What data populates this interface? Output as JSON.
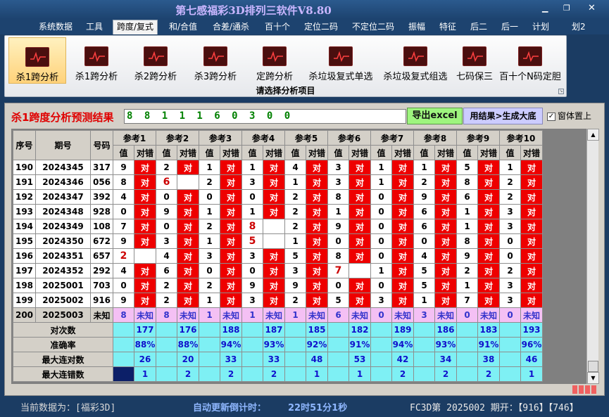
{
  "window": {
    "title": "第七感福彩3D排列三软件V8.80",
    "minimize_icon": "minimize-icon",
    "restore_icon": "restore-icon",
    "close_icon": "close-icon"
  },
  "menu": [
    "系统数据",
    "工具",
    "跨度/复式",
    "和/合值",
    "合差/通杀",
    "百十个",
    "定位二码",
    "不定位二码",
    "振幅",
    "特征",
    "后二",
    "后一",
    "计划",
    "划2"
  ],
  "active_menu": "跨度/复式",
  "ribbon": {
    "buttons": [
      "杀1跨分析",
      "杀1跨分析",
      "杀2跨分析",
      "杀3跨分析",
      "定跨分析",
      "杀垃圾复式单选",
      "杀垃圾复式组选",
      "七码保三",
      "百十个N码定胆"
    ],
    "active_index": 0,
    "caption": "请选择分析项目",
    "icon": "chart-icon"
  },
  "result": {
    "title": "杀1跨度分析预测结果",
    "value": "8 8 1 1 1 6 0 3 0 0",
    "excel_button": "导出excel",
    "generate_button": "用结果>生成大底",
    "pin_label": "窗体置上",
    "pin_checked": true
  },
  "table": {
    "col_seq": "序号",
    "col_period": "期号",
    "col_number": "号码",
    "refs": [
      "参考1",
      "参考2",
      "参考3",
      "参考4",
      "参考5",
      "参考6",
      "参考7",
      "参考8",
      "参考9",
      "参考10"
    ],
    "sub_val": "值",
    "sub_ok": "对错",
    "rows": [
      {
        "seq": "190",
        "period": "2024345",
        "num": "317",
        "vals": [
          "9",
          "2",
          "1",
          "1",
          "4",
          "3",
          "1",
          "1",
          "5",
          "1"
        ],
        "miss": []
      },
      {
        "seq": "191",
        "period": "2024346",
        "num": "056",
        "vals": [
          "8",
          "6",
          "2",
          "3",
          "1",
          "3",
          "1",
          "2",
          "8",
          "2"
        ],
        "miss": [
          1
        ]
      },
      {
        "seq": "192",
        "period": "2024347",
        "num": "392",
        "vals": [
          "4",
          "0",
          "0",
          "0",
          "2",
          "8",
          "0",
          "9",
          "6",
          "2"
        ],
        "miss": []
      },
      {
        "seq": "193",
        "period": "2024348",
        "num": "928",
        "vals": [
          "0",
          "9",
          "1",
          "1",
          "2",
          "1",
          "0",
          "6",
          "1",
          "3"
        ],
        "miss": []
      },
      {
        "seq": "194",
        "period": "2024349",
        "num": "108",
        "vals": [
          "7",
          "0",
          "2",
          "8",
          "2",
          "9",
          "0",
          "6",
          "1",
          "3"
        ],
        "miss": [
          3
        ]
      },
      {
        "seq": "195",
        "period": "2024350",
        "num": "672",
        "vals": [
          "9",
          "3",
          "1",
          "5",
          "1",
          "0",
          "0",
          "0",
          "8",
          "0"
        ],
        "miss": [
          3
        ]
      },
      {
        "seq": "196",
        "period": "2024351",
        "num": "657",
        "vals": [
          "2",
          "4",
          "3",
          "3",
          "5",
          "8",
          "0",
          "4",
          "9",
          "0"
        ],
        "miss": [
          0
        ]
      },
      {
        "seq": "197",
        "period": "2024352",
        "num": "292",
        "vals": [
          "4",
          "6",
          "0",
          "0",
          "3",
          "7",
          "1",
          "5",
          "2",
          "2"
        ],
        "miss": [
          5
        ]
      },
      {
        "seq": "198",
        "period": "2025001",
        "num": "703",
        "vals": [
          "0",
          "2",
          "2",
          "9",
          "9",
          "0",
          "0",
          "5",
          "1",
          "3"
        ],
        "miss": []
      },
      {
        "seq": "199",
        "period": "2025002",
        "num": "916",
        "vals": [
          "9",
          "2",
          "1",
          "3",
          "2",
          "5",
          "3",
          "1",
          "7",
          "3"
        ],
        "miss": []
      }
    ],
    "ok_text": "对",
    "pred_row": {
      "seq": "200",
      "period": "2025003",
      "num": "未知",
      "vals": [
        "8",
        "8",
        "1",
        "1",
        "1",
        "6",
        "0",
        "3",
        "0",
        "0"
      ],
      "status": "未知"
    },
    "stats": [
      {
        "label": "对次数",
        "values": [
          "177",
          "176",
          "188",
          "187",
          "185",
          "182",
          "189",
          "186",
          "183",
          "193"
        ]
      },
      {
        "label": "准确率",
        "values": [
          "88%",
          "88%",
          "94%",
          "93%",
          "92%",
          "91%",
          "94%",
          "93%",
          "91%",
          "96%"
        ]
      },
      {
        "label": "最大连对数",
        "values": [
          "26",
          "20",
          "33",
          "33",
          "48",
          "53",
          "42",
          "34",
          "38",
          "46"
        ]
      },
      {
        "label": "最大连错数",
        "values": [
          "1",
          "2",
          "2",
          "2",
          "1",
          "1",
          "2",
          "2",
          "2",
          "1"
        ]
      }
    ]
  },
  "status": {
    "current_data": "当前数据为：[福彩3D]",
    "countdown_label": "自动更新倒计时：",
    "countdown_value": "22时51分1秒",
    "draw_info": "FC3D第 2025002 期开：【916】【746】"
  }
}
